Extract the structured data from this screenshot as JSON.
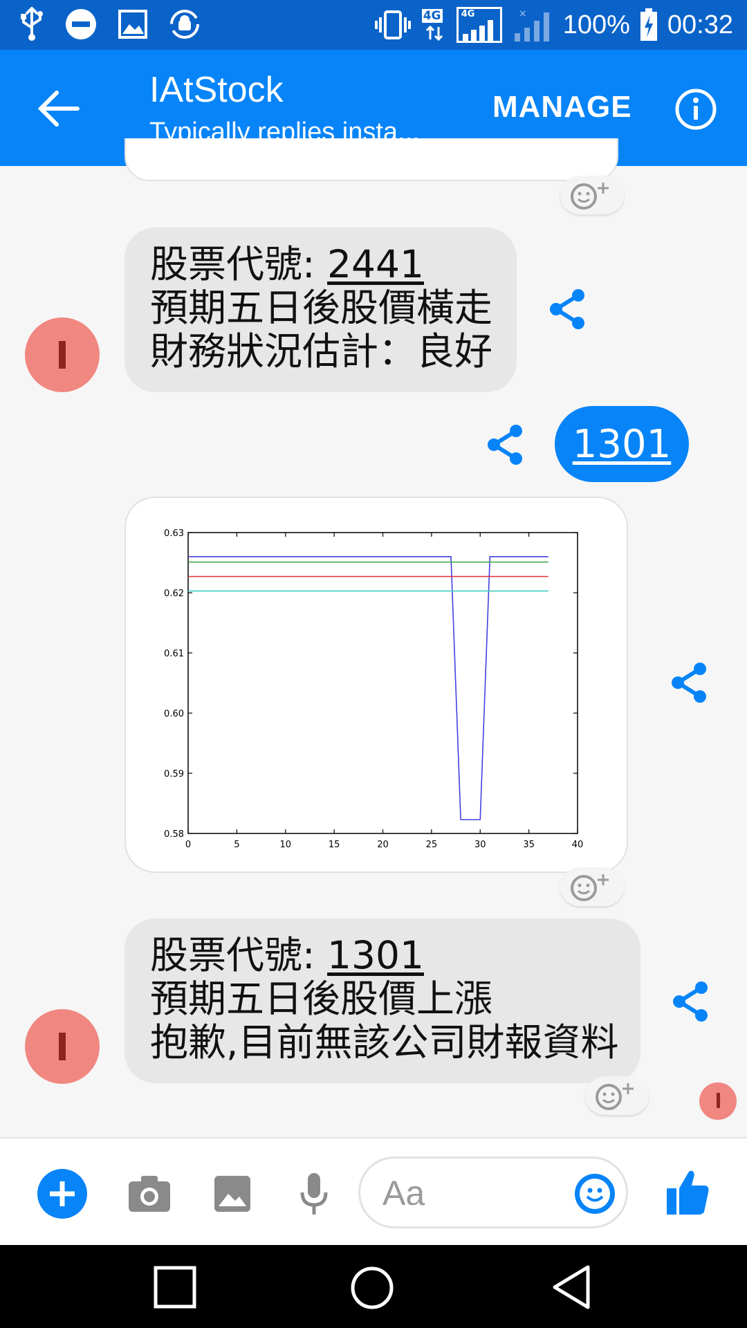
{
  "status_bar": {
    "battery": "100%",
    "time": "00:32",
    "network_label": "4G",
    "network_label_2": "4G"
  },
  "app_bar": {
    "title": "IAtStock",
    "subtitle": "Typically replies insta...",
    "manage_label": "MANAGE"
  },
  "messages": [
    {
      "sender": "bot",
      "prefix": "股票代號: ",
      "code": "2441",
      "line2": "預期五日後股價橫走",
      "line3": "財務狀況估計：良好"
    },
    {
      "sender": "user",
      "text": "1301"
    },
    {
      "sender": "bot",
      "prefix": "股票代號: ",
      "code": "1301",
      "line2": "預期五日後股價上漲",
      "line3": "抱歉,目前無該公司財報資料"
    }
  ],
  "composer": {
    "placeholder": "Aa"
  },
  "colors": {
    "accent": "#0784f8",
    "avatar": "#f08780",
    "status_bar": "#0a63c9"
  },
  "chart_data": {
    "type": "line",
    "xlim": [
      0,
      40
    ],
    "ylim": [
      0.58,
      0.63
    ],
    "xticks": [
      "0",
      "5",
      "10",
      "15",
      "20",
      "25",
      "30",
      "35",
      "40"
    ],
    "yticks": [
      "0.63",
      "0.62",
      "0.61",
      "0.60",
      "0.59",
      "0.58"
    ],
    "series": [
      {
        "color": "#4040e0",
        "x": [
          0,
          27,
          28,
          30,
          31,
          37
        ],
        "y": [
          0.626,
          0.626,
          0.5823,
          0.5823,
          0.626,
          0.626
        ]
      },
      {
        "color": "#3aa23a",
        "x": [
          0,
          37
        ],
        "y": [
          0.6251,
          0.6251
        ]
      },
      {
        "color": "#e03030",
        "x": [
          0,
          37
        ],
        "y": [
          0.6227,
          0.6227
        ]
      },
      {
        "color": "#3ecfc0",
        "x": [
          0,
          37
        ],
        "y": [
          0.6203,
          0.6203
        ]
      }
    ]
  }
}
